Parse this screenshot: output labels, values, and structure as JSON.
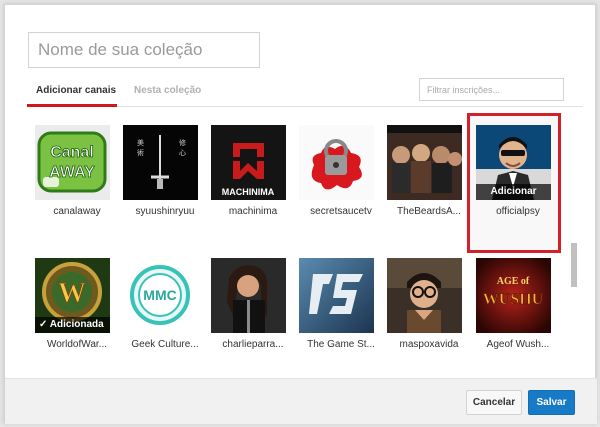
{
  "dialog": {
    "name_input": {
      "placeholder": "Nome de sua coleção",
      "value": ""
    },
    "tabs": [
      {
        "label": "Adicionar canais",
        "active": true
      },
      {
        "label": "Nesta coleção",
        "active": false
      }
    ],
    "filter": {
      "placeholder": "Filtrar inscrições...",
      "value": ""
    },
    "accent_color": "#cc181e",
    "highlight_color": "#d4202a"
  },
  "channels_row1": [
    {
      "name": "canalaway",
      "thumb_text": "Canal AWAY"
    },
    {
      "name": "syuushinryuu",
      "thumb_text": ""
    },
    {
      "name": "machinima",
      "thumb_text": "MACHINIMA"
    },
    {
      "name": "secretsaucetv",
      "thumb_text": ""
    },
    {
      "name": "TheBeardsA...",
      "thumb_text": ""
    },
    {
      "name": "officialpsy",
      "thumb_text": "",
      "overlay": "Adicionar"
    }
  ],
  "channels_row2": [
    {
      "name": "WorldofWar...",
      "thumb_text": "W",
      "overlay": "✓ Adicionada"
    },
    {
      "name": "Geek Culture...",
      "thumb_text": "MMC"
    },
    {
      "name": "charlieparra...",
      "thumb_text": ""
    },
    {
      "name": "The Game St...",
      "thumb_text": ""
    },
    {
      "name": "maspoxavida",
      "thumb_text": ""
    },
    {
      "name": "Ageof Wush...",
      "thumb_text": "WUSHU",
      "thumb_subtext": "AGE of"
    }
  ],
  "footer": {
    "cancel_label": "Cancelar",
    "save_label": "Salvar",
    "save_color": "#167ac6"
  }
}
